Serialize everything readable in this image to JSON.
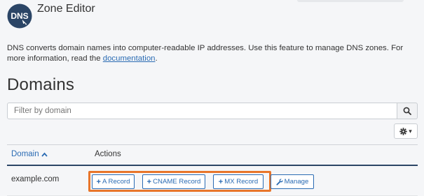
{
  "app": {
    "logo_text": "DNS",
    "title": "Zone Editor"
  },
  "intro": {
    "text": "DNS converts domain names into computer-readable IP addresses. Use this feature to manage DNS zones. For more information, read the ",
    "link_text": "documentation",
    "suffix": "."
  },
  "page": {
    "heading": "Domains"
  },
  "search": {
    "placeholder": "Filter by domain",
    "icon": "search-icon"
  },
  "settings": {
    "icon": "gear-icon",
    "caret": "▾"
  },
  "table": {
    "headers": {
      "domain": "Domain",
      "actions": "Actions"
    },
    "sort_indicator": "ascending",
    "rows": [
      {
        "domain": "example.com",
        "actions": {
          "a_record": "A Record",
          "cname_record": "CNAME Record",
          "mx_record": "MX Record",
          "manage": "Manage"
        }
      }
    ]
  },
  "colors": {
    "accent": "#2a6bb3",
    "highlight": "#e8752a",
    "header_rule": "#2b4566",
    "logo_bg": "#2b4566"
  }
}
